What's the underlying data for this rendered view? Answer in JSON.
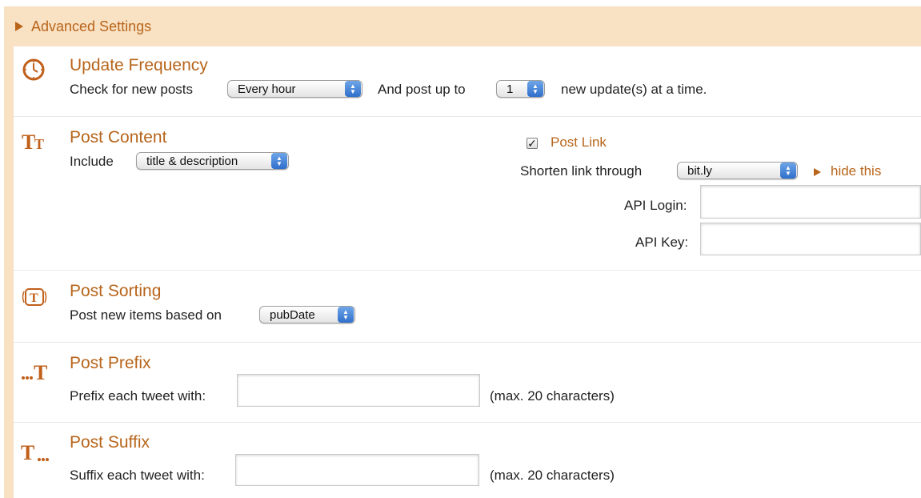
{
  "advanced": {
    "title": "Advanced Settings"
  },
  "update_frequency": {
    "title": "Update Frequency",
    "check_label": "Check for new posts",
    "frequency_value": "Every hour",
    "post_up_to_label": "And post up to",
    "count_value": "1",
    "suffix_label": "new update(s) at a time."
  },
  "post_content": {
    "title": "Post Content",
    "include_label": "Include",
    "include_value": "title & description",
    "post_link_label": "Post Link",
    "post_link_checked": true,
    "shorten_label": "Shorten link through",
    "shorten_value": "bit.ly",
    "hide_this_label": "hide this",
    "api_login_label": "API Login:",
    "api_login_value": "",
    "api_key_label": "API Key:",
    "api_key_value": ""
  },
  "post_sorting": {
    "title": "Post Sorting",
    "label": "Post new items based on",
    "value": "pubDate"
  },
  "post_prefix": {
    "title": "Post Prefix",
    "label": "Prefix each tweet with:",
    "value": "",
    "hint": "(max. 20 characters)"
  },
  "post_suffix": {
    "title": "Post Suffix",
    "label": "Suffix each tweet with:",
    "value": "",
    "hint": "(max. 20 characters)"
  },
  "icons": {
    "update_frequency": "clock-icon",
    "post_content": "text-size-icon",
    "post_sorting": "sort-text-icon",
    "post_prefix": "prefix-text-icon",
    "post_suffix": "suffix-text-icon"
  },
  "colors": {
    "accent": "#b8651b",
    "frame": "#f9e1c3",
    "select_arrow": "#2f6fcc"
  }
}
